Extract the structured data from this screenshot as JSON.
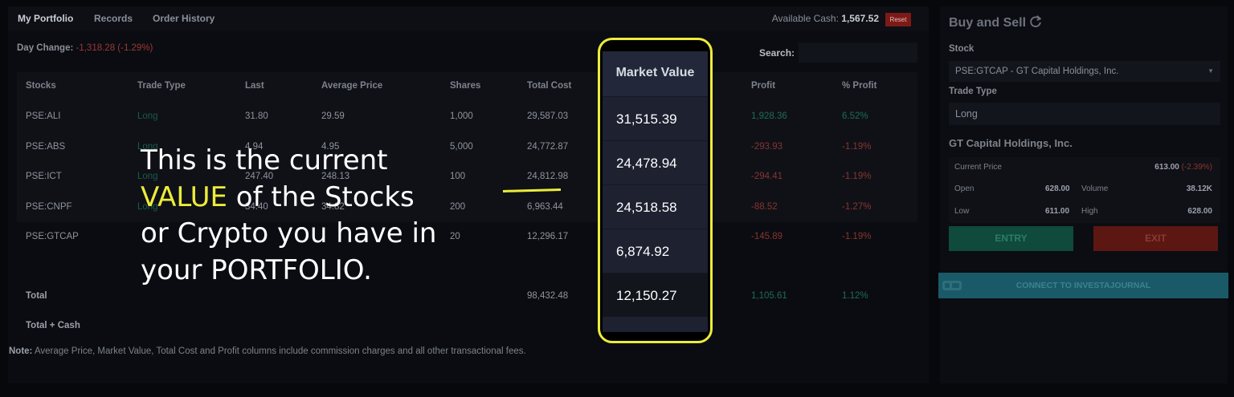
{
  "tabs": [
    {
      "label": "My Portfolio"
    },
    {
      "label": "Records"
    },
    {
      "label": "Order History"
    }
  ],
  "available_cash": {
    "label": "Available Cash:",
    "value": "1,567.52"
  },
  "reset_label": "Reset",
  "day_change": {
    "label": "Day Change:",
    "value": "-1,318.28 (-1.29%)"
  },
  "search_label": "Search:",
  "table": {
    "columns": [
      "Stocks",
      "Trade Type",
      "Last",
      "Average Price",
      "Shares",
      "Total Cost",
      "Profit",
      "% Profit"
    ],
    "rows": [
      {
        "stock": "PSE:ALI",
        "type": "Long",
        "last": "31.80",
        "avg": "29.59",
        "shares": "1,000",
        "cost": "29,587.03",
        "profit": "1,928.36",
        "pct": "6.52%"
      },
      {
        "stock": "PSE:ABS",
        "type": "Long",
        "last": "4.94",
        "avg": "4.95",
        "shares": "5,000",
        "cost": "24,772.87",
        "profit": "-293.93",
        "pct": "-1.19%"
      },
      {
        "stock": "PSE:ICT",
        "type": "Long",
        "last": "247.40",
        "avg": "248.13",
        "shares": "100",
        "cost": "24,812.98",
        "profit": "-294.41",
        "pct": "-1.19%"
      },
      {
        "stock": "PSE:CNPF",
        "type": "Long",
        "last": "34.40",
        "avg": "34.82",
        "shares": "200",
        "cost": "6,963.44",
        "profit": "-88.52",
        "pct": "-1.27%"
      },
      {
        "stock": "PSE:GTCAP",
        "type": "",
        "last": "",
        "avg": "",
        "shares": "20",
        "cost": "12,296.17",
        "profit": "-145.89",
        "pct": "-1.19%"
      }
    ],
    "total": {
      "label": "Total",
      "cost": "98,432.48",
      "profit": "1,105.61",
      "pct": "1.12%"
    },
    "total_cash_label": "Total + Cash"
  },
  "note": {
    "bold": "Note:",
    "text": " Average Price, Market Value, Total Cost and Profit columns include commission charges and all other transactional fees."
  },
  "trade_panel": {
    "title": "Buy and Sell",
    "stock_label": "Stock",
    "stock_value": "PSE:GTCAP - GT Capital Holdings, Inc.",
    "trade_type_label": "Trade Type",
    "trade_type_value": "Long",
    "company": "GT Capital Holdings, Inc.",
    "current_price_label": "Current Price",
    "current_price_value": "613.00",
    "current_price_change": "(-2.39%)",
    "open_label": "Open",
    "open_value": "628.00",
    "volume_label": "Volume",
    "volume_value": "38.12K",
    "low_label": "Low",
    "low_value": "611.00",
    "high_label": "High",
    "high_value": "628.00",
    "entry_label": "ENTRY",
    "exit_label": "EXIT",
    "connect_label": "CONNECT TO INVESTAJOURNAL"
  },
  "overlay": {
    "line1": "This is the current",
    "highlight": "VALUE",
    "line2_rest": " of the Stocks",
    "line3": "or Crypto you have in",
    "line4": "your PORTFOLIO."
  },
  "market_value": {
    "header": "Market Value",
    "values": [
      "31,515.39",
      "24,478.94",
      "24,518.58",
      "6,874.92",
      "12,150.27"
    ]
  },
  "colors": {
    "highlight": "#ecec3a",
    "profit_positive": "#1f6c58",
    "profit_negative": "#883530"
  }
}
